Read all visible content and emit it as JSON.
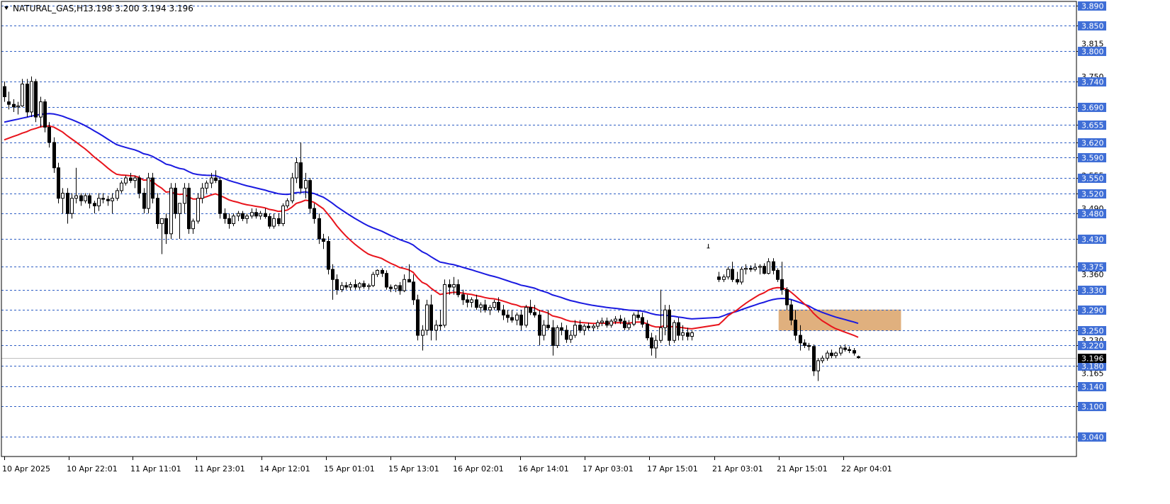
{
  "header": {
    "symbol_timeframe": "NATURAL_GAS,H1",
    "ohlc": "3.198 3.200 3.194 3.196"
  },
  "colors": {
    "background": "#ffffff",
    "candle_bull_body": "#ffffff",
    "candle_bear_body": "#000000",
    "candle_outline": "#000000",
    "level_line": "#2f5fc4",
    "level_label_bg": "#3f6ed6",
    "level_label_text": "#ffffff",
    "ma_fast": "#e8141c",
    "ma_slow": "#1a1ae0",
    "zone_fill": "#e0b07e",
    "current_price_label_bg": "#000000",
    "current_price_line": "#c0c0c0"
  },
  "chart_data": {
    "type": "candlestick",
    "title": "NATURAL_GAS,H1",
    "ylim": [
      3.025,
      3.895
    ],
    "grid": false,
    "y_tick_labels": [
      "3.815",
      "3.750",
      "3.555",
      "3.490",
      "3.360",
      "3.230",
      "3.165"
    ],
    "levels": [
      3.89,
      3.85,
      3.8,
      3.74,
      3.69,
      3.655,
      3.62,
      3.59,
      3.55,
      3.52,
      3.48,
      3.43,
      3.375,
      3.33,
      3.29,
      3.25,
      3.22,
      3.18,
      3.14,
      3.1,
      3.04
    ],
    "current_price": 3.196,
    "x_tick_labels": [
      "10 Apr 2025",
      "10 Apr 22:01",
      "11 Apr 11:01",
      "11 Apr 23:01",
      "14 Apr 12:01",
      "15 Apr 01:01",
      "15 Apr 13:01",
      "16 Apr 02:01",
      "16 Apr 14:01",
      "17 Apr 03:01",
      "17 Apr 15:01",
      "21 Apr 03:01",
      "21 Apr 15:01",
      "22 Apr 04:01"
    ],
    "zone": {
      "from": 3.25,
      "to": 3.29
    },
    "series": [
      {
        "kind": "ohlc",
        "ohlc": [
          [
            3.73,
            3.74,
            3.7,
            3.71
          ],
          [
            3.7,
            3.72,
            3.685,
            3.695
          ],
          [
            3.695,
            3.705,
            3.68,
            3.69
          ],
          [
            3.69,
            3.7,
            3.675,
            3.692
          ],
          [
            3.692,
            3.745,
            3.69,
            3.735
          ],
          [
            3.735,
            3.745,
            3.67,
            3.68
          ],
          [
            3.68,
            3.75,
            3.67,
            3.74
          ],
          [
            3.74,
            3.745,
            3.66,
            3.67
          ],
          [
            3.67,
            3.71,
            3.65,
            3.7
          ],
          [
            3.7,
            3.705,
            3.64,
            3.65
          ],
          [
            3.65,
            3.66,
            3.61,
            3.62
          ],
          [
            3.62,
            3.63,
            3.56,
            3.57
          ],
          [
            3.57,
            3.58,
            3.5,
            3.51
          ],
          [
            3.51,
            3.53,
            3.48,
            3.52
          ],
          [
            3.52,
            3.53,
            3.46,
            3.48
          ],
          [
            3.48,
            3.52,
            3.47,
            3.51
          ],
          [
            3.51,
            3.57,
            3.5,
            3.515
          ],
          [
            3.515,
            3.52,
            3.495,
            3.505
          ],
          [
            3.505,
            3.52,
            3.5,
            3.515
          ],
          [
            3.515,
            3.52,
            3.49,
            3.5
          ],
          [
            3.5,
            3.505,
            3.48,
            3.495
          ],
          [
            3.495,
            3.52,
            3.485,
            3.51
          ],
          [
            3.51,
            3.52,
            3.5,
            3.508
          ],
          [
            3.508,
            3.515,
            3.495,
            3.505
          ],
          [
            3.505,
            3.52,
            3.48,
            3.51
          ],
          [
            3.51,
            3.53,
            3.505,
            3.525
          ],
          [
            3.525,
            3.545,
            3.52,
            3.54
          ],
          [
            3.54,
            3.555,
            3.535,
            3.55
          ],
          [
            3.55,
            3.56,
            3.54,
            3.545
          ],
          [
            3.545,
            3.555,
            3.53,
            3.55
          ],
          [
            3.55,
            3.555,
            3.51,
            3.52
          ],
          [
            3.52,
            3.53,
            3.48,
            3.49
          ],
          [
            3.49,
            3.56,
            3.48,
            3.55
          ],
          [
            3.55,
            3.56,
            3.5,
            3.51
          ],
          [
            3.51,
            3.52,
            3.45,
            3.46
          ],
          [
            3.46,
            3.47,
            3.4,
            3.47
          ],
          [
            3.47,
            3.48,
            3.42,
            3.44
          ],
          [
            3.44,
            3.54,
            3.43,
            3.53
          ],
          [
            3.53,
            3.54,
            3.47,
            3.48
          ],
          [
            3.48,
            3.5,
            3.43,
            3.5
          ],
          [
            3.5,
            3.54,
            3.48,
            3.53
          ],
          [
            3.53,
            3.54,
            3.44,
            3.45
          ],
          [
            3.45,
            3.47,
            3.44,
            3.465
          ],
          [
            3.465,
            3.52,
            3.46,
            3.51
          ],
          [
            3.51,
            3.54,
            3.5,
            3.53
          ],
          [
            3.53,
            3.545,
            3.52,
            3.54
          ],
          [
            3.54,
            3.56,
            3.53,
            3.55
          ],
          [
            3.55,
            3.565,
            3.54,
            3.545
          ],
          [
            3.545,
            3.55,
            3.47,
            3.48
          ],
          [
            3.48,
            3.49,
            3.46,
            3.47
          ],
          [
            3.47,
            3.48,
            3.45,
            3.46
          ],
          [
            3.46,
            3.48,
            3.455,
            3.475
          ],
          [
            3.475,
            3.485,
            3.465,
            3.48
          ],
          [
            3.48,
            3.485,
            3.465,
            3.47
          ],
          [
            3.47,
            3.48,
            3.46,
            3.475
          ],
          [
            3.475,
            3.49,
            3.47,
            3.482
          ],
          [
            3.482,
            3.49,
            3.47,
            3.475
          ],
          [
            3.475,
            3.485,
            3.468,
            3.48
          ],
          [
            3.48,
            3.49,
            3.47,
            3.474
          ],
          [
            3.474,
            3.48,
            3.45,
            3.455
          ],
          [
            3.455,
            3.48,
            3.45,
            3.47
          ],
          [
            3.47,
            3.48,
            3.455,
            3.46
          ],
          [
            3.46,
            3.5,
            3.455,
            3.495
          ],
          [
            3.495,
            3.51,
            3.49,
            3.505
          ],
          [
            3.505,
            3.56,
            3.5,
            3.55
          ],
          [
            3.55,
            3.59,
            3.54,
            3.58
          ],
          [
            3.58,
            3.62,
            3.52,
            3.53
          ],
          [
            3.53,
            3.56,
            3.51,
            3.545
          ],
          [
            3.545,
            3.55,
            3.48,
            3.49
          ],
          [
            3.49,
            3.5,
            3.46,
            3.47
          ],
          [
            3.47,
            3.48,
            3.42,
            3.43
          ],
          [
            3.43,
            3.44,
            3.41,
            3.425
          ],
          [
            3.425,
            3.435,
            3.36,
            3.37
          ],
          [
            3.37,
            3.38,
            3.31,
            3.35
          ],
          [
            3.35,
            3.36,
            3.32,
            3.33
          ],
          [
            3.33,
            3.345,
            3.325,
            3.338
          ],
          [
            3.338,
            3.345,
            3.33,
            3.335
          ],
          [
            3.335,
            3.345,
            3.328,
            3.34
          ],
          [
            3.34,
            3.35,
            3.33,
            3.335
          ],
          [
            3.335,
            3.345,
            3.33,
            3.342
          ],
          [
            3.342,
            3.348,
            3.332,
            3.336
          ],
          [
            3.336,
            3.342,
            3.33,
            3.338
          ],
          [
            3.338,
            3.365,
            3.335,
            3.36
          ],
          [
            3.36,
            3.37,
            3.355,
            3.368
          ],
          [
            3.368,
            3.372,
            3.355,
            3.362
          ],
          [
            3.362,
            3.368,
            3.33,
            3.335
          ],
          [
            3.335,
            3.34,
            3.325,
            3.332
          ],
          [
            3.332,
            3.34,
            3.325,
            3.338
          ],
          [
            3.338,
            3.345,
            3.32,
            3.328
          ],
          [
            3.328,
            3.36,
            3.325,
            3.35
          ],
          [
            3.35,
            3.38,
            3.345,
            3.345
          ],
          [
            3.345,
            3.36,
            3.3,
            3.31
          ],
          [
            3.31,
            3.32,
            3.23,
            3.24
          ],
          [
            3.24,
            3.26,
            3.21,
            3.25
          ],
          [
            3.25,
            3.31,
            3.24,
            3.3
          ],
          [
            3.3,
            3.32,
            3.23,
            3.25
          ],
          [
            3.25,
            3.27,
            3.23,
            3.26
          ],
          [
            3.26,
            3.29,
            3.25,
            3.26
          ],
          [
            3.26,
            3.35,
            3.255,
            3.34
          ],
          [
            3.34,
            3.35,
            3.32,
            3.335
          ],
          [
            3.335,
            3.355,
            3.32,
            3.34
          ],
          [
            3.34,
            3.35,
            3.315,
            3.32
          ],
          [
            3.32,
            3.33,
            3.3,
            3.31
          ],
          [
            3.31,
            3.32,
            3.295,
            3.305
          ],
          [
            3.305,
            3.315,
            3.295,
            3.31
          ],
          [
            3.31,
            3.32,
            3.29,
            3.295
          ],
          [
            3.295,
            3.305,
            3.285,
            3.3
          ],
          [
            3.3,
            3.31,
            3.285,
            3.29
          ],
          [
            3.29,
            3.3,
            3.28,
            3.295
          ],
          [
            3.295,
            3.31,
            3.29,
            3.305
          ],
          [
            3.305,
            3.315,
            3.285,
            3.29
          ],
          [
            3.29,
            3.3,
            3.27,
            3.28
          ],
          [
            3.28,
            3.29,
            3.265,
            3.275
          ],
          [
            3.275,
            3.29,
            3.265,
            3.27
          ],
          [
            3.27,
            3.285,
            3.26,
            3.28
          ],
          [
            3.28,
            3.29,
            3.25,
            3.26
          ],
          [
            3.26,
            3.3,
            3.255,
            3.295
          ],
          [
            3.295,
            3.31,
            3.28,
            3.285
          ],
          [
            3.285,
            3.3,
            3.275,
            3.28
          ],
          [
            3.28,
            3.29,
            3.22,
            3.24
          ],
          [
            3.24,
            3.27,
            3.23,
            3.26
          ],
          [
            3.26,
            3.29,
            3.25,
            3.255
          ],
          [
            3.255,
            3.27,
            3.2,
            3.22
          ],
          [
            3.22,
            3.26,
            3.215,
            3.255
          ],
          [
            3.255,
            3.265,
            3.24,
            3.25
          ],
          [
            3.25,
            3.26,
            3.225,
            3.232
          ],
          [
            3.232,
            3.25,
            3.225,
            3.24
          ],
          [
            3.24,
            3.27,
            3.235,
            3.26
          ],
          [
            3.26,
            3.27,
            3.245,
            3.25
          ],
          [
            3.25,
            3.262,
            3.24,
            3.258
          ],
          [
            3.258,
            3.265,
            3.25,
            3.255
          ],
          [
            3.255,
            3.262,
            3.248,
            3.258
          ],
          [
            3.258,
            3.27,
            3.252,
            3.265
          ],
          [
            3.265,
            3.275,
            3.258,
            3.268
          ],
          [
            3.268,
            3.275,
            3.255,
            3.26
          ],
          [
            3.26,
            3.272,
            3.255,
            3.268
          ],
          [
            3.268,
            3.278,
            3.262,
            3.272
          ],
          [
            3.272,
            3.28,
            3.262,
            3.268
          ],
          [
            3.268,
            3.275,
            3.25,
            3.255
          ],
          [
            3.255,
            3.27,
            3.25,
            3.262
          ],
          [
            3.262,
            3.285,
            3.258,
            3.28
          ],
          [
            3.28,
            3.29,
            3.27,
            3.275
          ],
          [
            3.275,
            3.285,
            3.255,
            3.262
          ],
          [
            3.262,
            3.27,
            3.23,
            3.235
          ],
          [
            3.235,
            3.245,
            3.2,
            3.215
          ],
          [
            3.215,
            3.24,
            3.195,
            3.23
          ],
          [
            3.23,
            3.33,
            3.225,
            3.255
          ],
          [
            3.255,
            3.3,
            3.24,
            3.29
          ],
          [
            3.29,
            3.3,
            3.22,
            3.23
          ],
          [
            3.23,
            3.27,
            3.225,
            3.265
          ],
          [
            3.265,
            3.275,
            3.23,
            3.24
          ],
          [
            3.24,
            3.26,
            3.23,
            3.245
          ],
          [
            3.245,
            3.255,
            3.23,
            3.238
          ],
          [
            3.238,
            3.25,
            3.23,
            3.245
          ],
          [
            3.355,
            3.365,
            3.345,
            3.35
          ],
          [
            3.35,
            3.36,
            3.345,
            3.355
          ],
          [
            3.355,
            3.375,
            3.35,
            3.37
          ],
          [
            3.37,
            3.385,
            3.345,
            3.35
          ],
          [
            3.35,
            3.365,
            3.34,
            3.345
          ],
          [
            3.345,
            3.375,
            3.34,
            3.37
          ],
          [
            3.37,
            3.38,
            3.36,
            3.372
          ],
          [
            3.372,
            3.378,
            3.365,
            3.37
          ],
          [
            3.37,
            3.382,
            3.366,
            3.374
          ],
          [
            3.374,
            3.38,
            3.36,
            3.376
          ],
          [
            3.376,
            3.382,
            3.36,
            3.362
          ],
          [
            3.362,
            3.392,
            3.36,
            3.385
          ],
          [
            3.385,
            3.392,
            3.36,
            3.368
          ],
          [
            3.368,
            3.372,
            3.345,
            3.35
          ],
          [
            3.35,
            3.385,
            3.32,
            3.33
          ],
          [
            3.33,
            3.335,
            3.29,
            3.3
          ],
          [
            3.3,
            3.31,
            3.26,
            3.27
          ],
          [
            3.27,
            3.29,
            3.23,
            3.24
          ],
          [
            3.24,
            3.26,
            3.21,
            3.225
          ],
          [
            3.225,
            3.232,
            3.215,
            3.22
          ],
          [
            3.22,
            3.225,
            3.21,
            3.218
          ],
          [
            3.218,
            3.222,
            3.16,
            3.17
          ],
          [
            3.17,
            3.195,
            3.15,
            3.19
          ],
          [
            3.19,
            3.2,
            3.185,
            3.195
          ],
          [
            3.195,
            3.21,
            3.19,
            3.205
          ],
          [
            3.205,
            3.212,
            3.195,
            3.2
          ],
          [
            3.2,
            3.208,
            3.195,
            3.205
          ],
          [
            3.205,
            3.22,
            3.2,
            3.215
          ],
          [
            3.215,
            3.222,
            3.208,
            3.212
          ],
          [
            3.212,
            3.218,
            3.205,
            3.21
          ],
          [
            3.21,
            3.215,
            3.2,
            3.205
          ],
          [
            3.198,
            3.2,
            3.194,
            3.196
          ]
        ]
      }
    ]
  }
}
